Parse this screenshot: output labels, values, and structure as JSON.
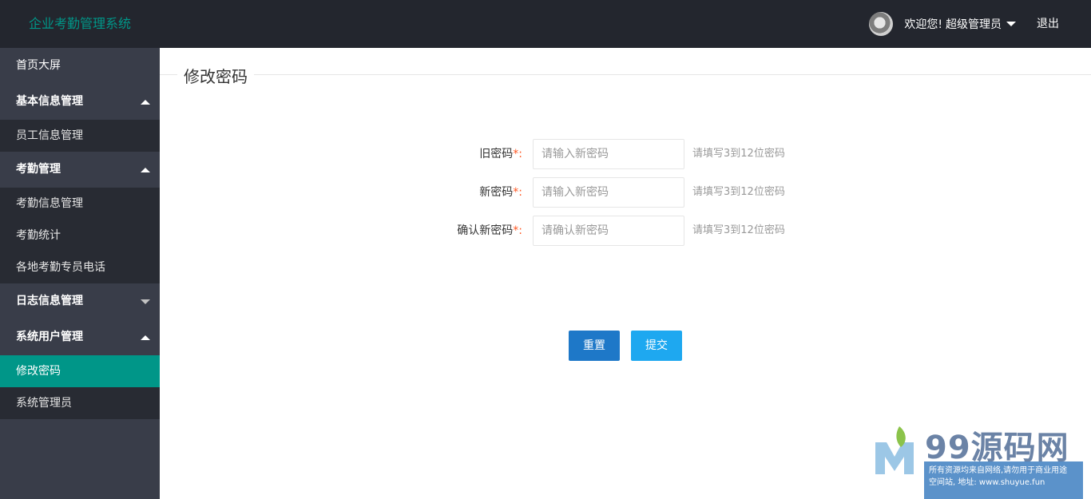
{
  "header": {
    "app_title": "企业考勤管理系统",
    "welcome_text": "欢迎您!",
    "username": "超级管理员",
    "logout_label": "退出",
    "bg_color": "#23262e",
    "accent_color": "#009688"
  },
  "sidebar": {
    "items": [
      {
        "label": "首页大屏"
      },
      {
        "label": "基本信息管理",
        "expanded": true
      },
      {
        "label": "员工信息管理"
      },
      {
        "label": "考勤管理",
        "expanded": true
      },
      {
        "label": "考勤信息管理"
      },
      {
        "label": "考勤统计"
      },
      {
        "label": "各地考勤专员电话"
      },
      {
        "label": "日志信息管理",
        "expanded": false
      },
      {
        "label": "系统用户管理",
        "expanded": true
      },
      {
        "label": "修改密码",
        "active": true
      },
      {
        "label": "系统管理员"
      }
    ]
  },
  "main": {
    "section_title": "修改密码",
    "form": {
      "old_password": {
        "label": "旧密码",
        "required_mark": "*",
        "colon": ":",
        "placeholder": "请输入新密码",
        "hint": "请填写3到12位密码"
      },
      "new_password": {
        "label": "新密码",
        "required_mark": "*",
        "colon": ":",
        "placeholder": "请输入新密码",
        "hint": "请填写3到12位密码"
      },
      "confirm_password": {
        "label": "确认新密码",
        "required_mark": "*",
        "colon": ":",
        "placeholder": "请确认新密码",
        "hint": "请填写3到12位密码"
      }
    },
    "buttons": {
      "reset_label": "重置",
      "submit_label": "提交"
    }
  },
  "watermark": {
    "brand": "99源码网",
    "line1": "所有资源均来自网络,请勿用于商业用途",
    "line2": "空间站, 地址: www.shuyue.fun"
  }
}
